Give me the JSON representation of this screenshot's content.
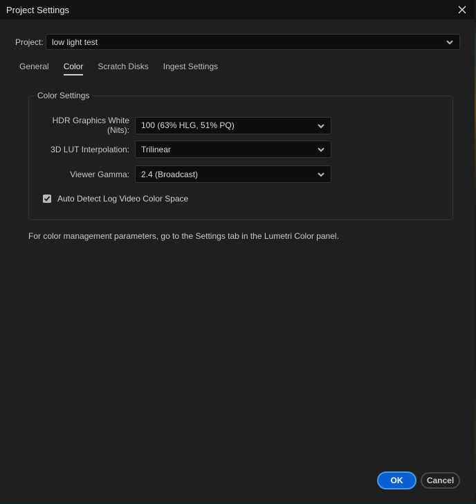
{
  "window": {
    "title": "Project Settings",
    "close_icon": "close-icon"
  },
  "project": {
    "label": "Project:",
    "value": "low light test"
  },
  "tabs": [
    {
      "label": "General",
      "active": false
    },
    {
      "label": "Color",
      "active": true
    },
    {
      "label": "Scratch Disks",
      "active": false
    },
    {
      "label": "Ingest Settings",
      "active": false
    }
  ],
  "color_settings": {
    "legend": "Color Settings",
    "fields": [
      {
        "label": "HDR Graphics White (Nits):",
        "value": "100 (63% HLG, 51% PQ)"
      },
      {
        "label": "3D LUT Interpolation:",
        "value": "Trilinear"
      },
      {
        "label": "Viewer Gamma:",
        "value": "2.4 (Broadcast)"
      }
    ],
    "auto_detect": {
      "label": "Auto Detect Log Video Color Space",
      "checked": true
    }
  },
  "info_text": "For color management parameters, go to the Settings tab in the Lumetri Color panel.",
  "buttons": {
    "ok": "OK",
    "cancel": "Cancel"
  },
  "colors": {
    "accent": "#0a5fd0",
    "accent_border": "#4a9be8",
    "background": "#1f1f1f",
    "titlebar": "#121212"
  }
}
